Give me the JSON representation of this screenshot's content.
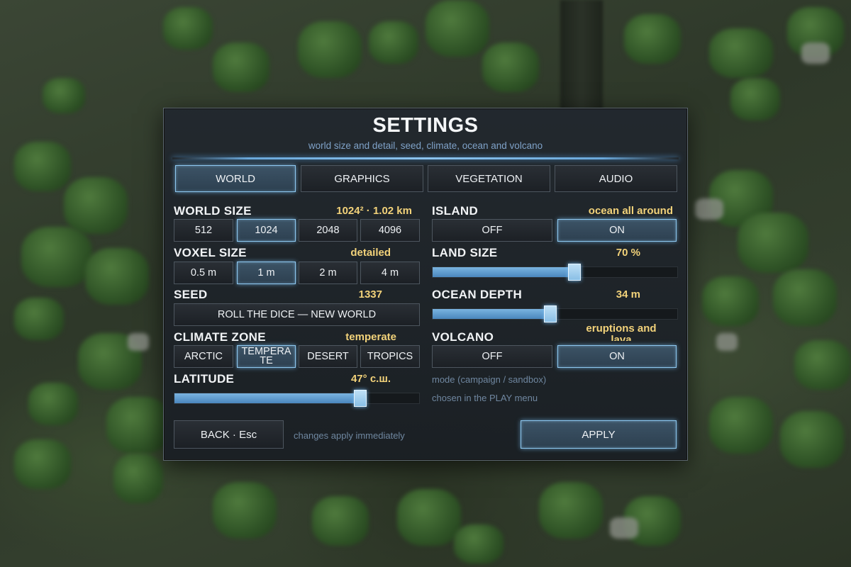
{
  "panel": {
    "title": "SETTINGS",
    "subtitle": "world size and detail, seed, climate, ocean and volcano"
  },
  "tabs": [
    {
      "label": "WORLD",
      "active": true
    },
    {
      "label": "GRAPHICS",
      "active": false
    },
    {
      "label": "VEGETATION",
      "active": false
    },
    {
      "label": "AUDIO",
      "active": false
    }
  ],
  "world_size": {
    "label": "WORLD SIZE",
    "value": "1024² · 1.02 km",
    "options": [
      "512",
      "1024",
      "2048",
      "4096"
    ],
    "selected": "1024"
  },
  "voxel_size": {
    "label": "VOXEL SIZE",
    "value": "detailed",
    "options": [
      "0.5 m",
      "1 m",
      "2 m",
      "4 m"
    ],
    "selected": "1 m"
  },
  "seed": {
    "label": "SEED",
    "value": "1337",
    "roll_label": "ROLL THE DICE — NEW WORLD"
  },
  "climate": {
    "label": "CLIMATE ZONE",
    "value": "temperate",
    "options": [
      "ARCTIC",
      "TEMPERATE",
      "DESERT",
      "TROPICS"
    ],
    "selected": "TEMPERATE"
  },
  "latitude": {
    "label": "LATITUDE",
    "value": "47° с.ш.",
    "fraction": 0.76
  },
  "island": {
    "label": "ISLAND",
    "value": "ocean all around",
    "off_label": "OFF",
    "on_label": "ON",
    "state": "on"
  },
  "land_size": {
    "label": "LAND SIZE",
    "value": "70 %",
    "fraction": 0.58
  },
  "ocean_depth": {
    "label": "OCEAN DEPTH",
    "value": "34 m",
    "fraction": 0.48
  },
  "volcano": {
    "label": "VOLCANO",
    "value": "eruptions and lava",
    "off_label": "OFF",
    "on_label": "ON",
    "state": "on"
  },
  "mode_note": {
    "line1": "mode (campaign / sandbox)",
    "line2": "chosen in the PLAY menu"
  },
  "footer": {
    "back_label": "BACK · Esc",
    "note": "changes apply immediately",
    "apply_label": "APPLY"
  },
  "colors": {
    "accent": "#8ec8f0",
    "value_text": "#f2d27a",
    "note_text": "#6f87a0"
  }
}
